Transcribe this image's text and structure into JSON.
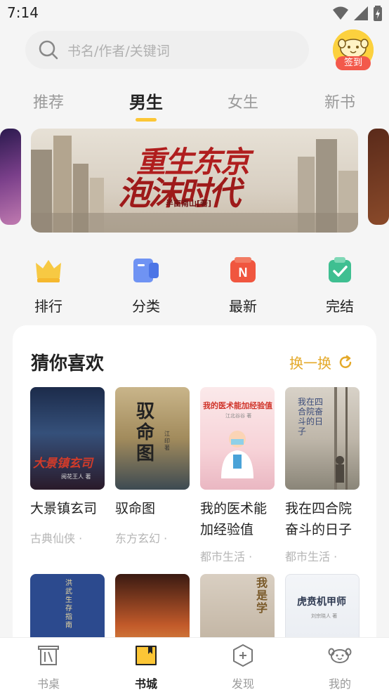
{
  "status_bar": {
    "time": "7:14"
  },
  "search": {
    "placeholder": "书名/作者/关键词"
  },
  "checkin": {
    "label": "签到"
  },
  "tabs": [
    {
      "label": "推荐",
      "active": false
    },
    {
      "label": "男生",
      "active": true
    },
    {
      "label": "女生",
      "active": false
    },
    {
      "label": "新书",
      "active": false
    }
  ],
  "banner": {
    "title_line1": "重生东京",
    "title_line2": "泡沫时代",
    "author": "半亩南山[著]"
  },
  "quick_nav": [
    {
      "label": "排行",
      "icon": "crown-icon",
      "color": "#f7c943"
    },
    {
      "label": "分类",
      "icon": "category-icon",
      "color": "#5d8cf2"
    },
    {
      "label": "最新",
      "icon": "new-icon",
      "color": "#f0563f"
    },
    {
      "label": "完结",
      "icon": "check-icon",
      "color": "#3fbf91"
    }
  ],
  "recommend": {
    "title": "猜你喜欢",
    "refresh_label": "换一换",
    "books": [
      {
        "title": "大景镇玄司",
        "meta": "古典仙侠 ·",
        "cover_text": "大景镇玄司",
        "cover_author": "阅花王人 著"
      },
      {
        "title": "驭命图",
        "meta": "东方玄幻 ·",
        "cover_text": "驭命图",
        "cover_author": "江印 著"
      },
      {
        "title": "我的医术能加经验值",
        "meta": "都市生活 ·",
        "cover_text": "我的医术能加经验值",
        "cover_author": "江北谷谷 著"
      },
      {
        "title": "我在四合院奋斗的日子",
        "meta": "都市生活 ·",
        "cover_text": "我在四合院奋斗的日子",
        "cover_author": ""
      }
    ],
    "books_row2": [
      {
        "cover_text": "洪武生存指南"
      },
      {
        "cover_text": ""
      },
      {
        "cover_text": "我是学"
      },
      {
        "cover_text": "虎贲机甲师",
        "cover_author": "刘宗晓人 著"
      }
    ]
  },
  "bottom_nav": [
    {
      "label": "书桌",
      "icon": "bookshelf-icon",
      "active": false
    },
    {
      "label": "书城",
      "icon": "bookstore-icon",
      "active": true
    },
    {
      "label": "发现",
      "icon": "discover-icon",
      "active": false
    },
    {
      "label": "我的",
      "icon": "profile-icon",
      "active": false
    }
  ],
  "colors": {
    "accent": "#fcc636",
    "refresh": "#e4a92a",
    "badge": "#f3594b"
  }
}
